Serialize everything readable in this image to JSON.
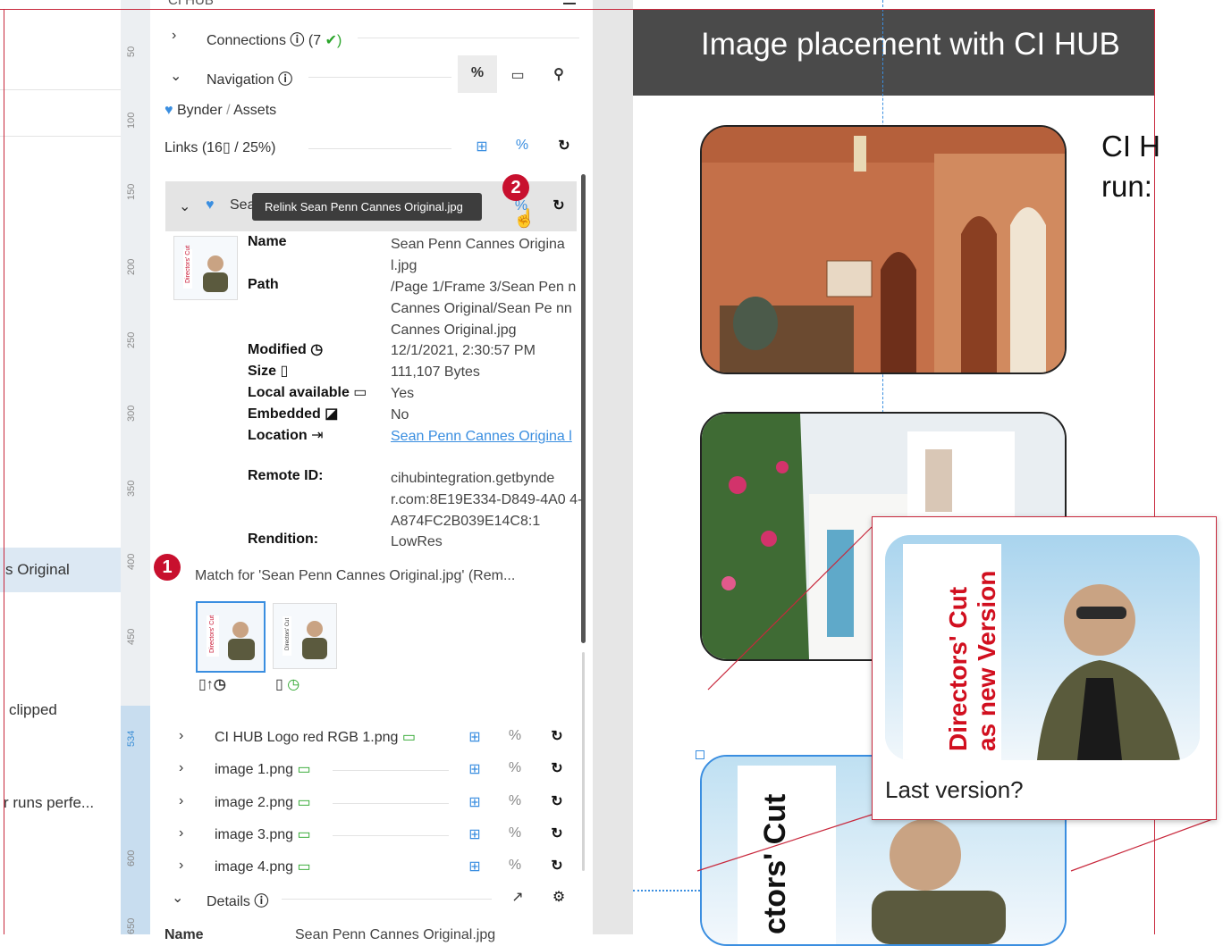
{
  "left_panel": {
    "items": [
      {
        "label": "s Original",
        "selected": true
      },
      {
        "label": "clipped",
        "selected": false
      },
      {
        "label": "r runs perfe...",
        "selected": false
      }
    ]
  },
  "ruler": {
    "ticks": [
      "50",
      "100",
      "150",
      "200",
      "250",
      "300",
      "350",
      "400",
      "450",
      "534",
      "600",
      "650"
    ],
    "current": "534"
  },
  "panel": {
    "header_cut": "CI HUB",
    "connections": {
      "label": "Connections",
      "count": "(7",
      "status": "✔)"
    },
    "navigation": {
      "label": "Navigation"
    },
    "breadcrumb": {
      "root": "Bynder",
      "sep": "/",
      "folder": "Assets"
    },
    "links_summary": {
      "label": "Links",
      "open": "(16",
      "mid": "/ 25",
      "close": ")"
    },
    "selected_item": {
      "label": "Sea",
      "tooltip": "Relink Sean Penn Cannes Original.jpg"
    },
    "details": {
      "name_key": "Name",
      "name_val": "Sean Penn Cannes Origina l.jpg",
      "path_key": "Path",
      "path_val": "/Page 1/Frame 3/Sean Pen n Cannes Original/Sean Pe nn Cannes Original.jpg",
      "modified_key": "Modified",
      "modified_val": "12/1/2021, 2:30:57 PM",
      "size_key": "Size",
      "size_val": "111,107 Bytes",
      "local_key": "Local available",
      "local_val": "Yes",
      "embedded_key": "Embedded",
      "embedded_val": "No",
      "location_key": "Location",
      "location_val": "Sean Penn Cannes Origina l",
      "remote_key": "Remote ID:",
      "remote_val": "cihubintegration.getbynde r.com:8E19E334-D849-4A0 4-A874FC2B039E14C8:1",
      "rendition_key": "Rendition:",
      "rendition_val": "LowRes"
    },
    "match_text": "Match for 'Sean Penn Cannes Original.jpg' (Rem...",
    "files": [
      {
        "label": "CI HUB Logo red RGB 1.png"
      },
      {
        "label": "image 1.png"
      },
      {
        "label": "image 2.png"
      },
      {
        "label": "image 3.png"
      },
      {
        "label": "image 4.png"
      }
    ],
    "details_section": {
      "label": "Details"
    },
    "bottom_cut": {
      "key": "Name",
      "val": "Sean Penn Cannes Original.jpg"
    }
  },
  "badges": {
    "one": "1",
    "two": "2"
  },
  "canvas": {
    "banner_title": "Image placement with CI HUB",
    "side_text_1": "CI H",
    "side_text_2": "run:",
    "poster_text": "ctors' Cut"
  },
  "callout": {
    "poster_line1": "Directors' Cut",
    "poster_line2": "as new Version",
    "caption": "Last version?"
  },
  "colors": {
    "accent_red": "#c8102e",
    "link_blue": "#3a8ee0",
    "banner": "#4a4a4a"
  }
}
